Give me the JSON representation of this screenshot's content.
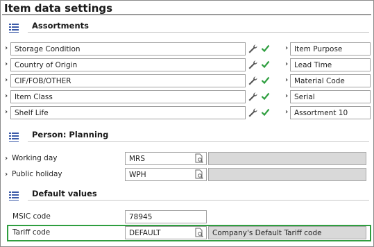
{
  "page": {
    "title": "Item data settings"
  },
  "assortments": {
    "title": "Assortments",
    "left_items": [
      "Storage Condition",
      "Country of Origin",
      "CIF/FOB/OTHER",
      "Item Class",
      "Shelf Life"
    ],
    "right_items": [
      "Item Purpose",
      "Lead Time",
      "Material Code",
      "Serial",
      "Assortment 10"
    ]
  },
  "planning": {
    "title": "Person: Planning",
    "working_day": {
      "label": "Working day",
      "value": "MRS",
      "description": ""
    },
    "public_holiday": {
      "label": "Public holiday",
      "value": "WPH",
      "description": ""
    }
  },
  "defaults": {
    "title": "Default values",
    "msic": {
      "label": "MSIC code",
      "value": "78945"
    },
    "tariff": {
      "label": "Tariff code",
      "value": "DEFAULT",
      "description": "Company's Default Tariff code"
    }
  },
  "colors": {
    "check": "#2e9e3f",
    "highlight": "#2e9e3f",
    "section_icon": "#3b5aa8"
  },
  "icons": {
    "section": "list-section-icon",
    "edit": "wrench-icon",
    "valid": "checkmark-icon",
    "lookup": "document-search-icon",
    "expand": "chevron-right-icon"
  }
}
